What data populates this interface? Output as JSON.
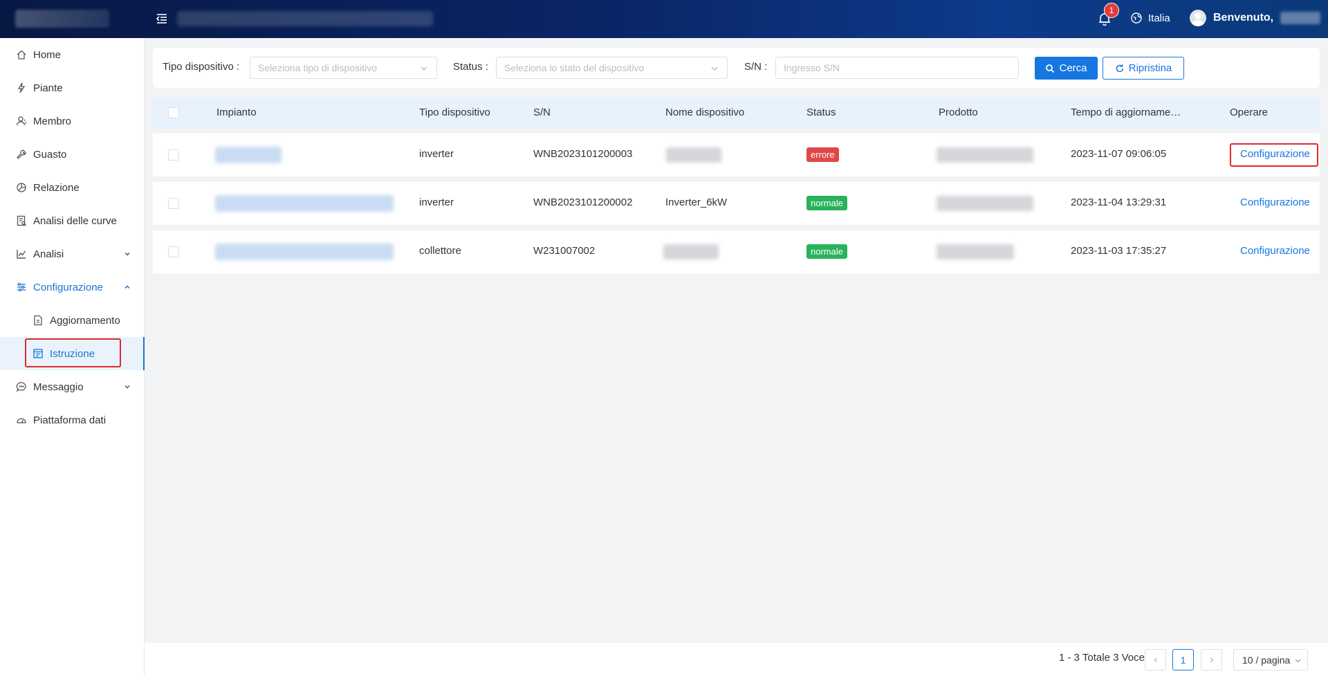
{
  "header": {
    "notification_count": "1",
    "language": "Italia",
    "welcome": "Benvenuto,"
  },
  "sidebar": {
    "items": [
      {
        "label": "Home",
        "icon": "home-icon"
      },
      {
        "label": "Piante",
        "icon": "plant-icon"
      },
      {
        "label": "Membro",
        "icon": "member-icon"
      },
      {
        "label": "Guasto",
        "icon": "wrench-icon"
      },
      {
        "label": "Relazione",
        "icon": "relation-icon"
      },
      {
        "label": "Analisi delle curve",
        "icon": "curve-analysis-icon"
      },
      {
        "label": "Analisi",
        "icon": "chart-icon"
      },
      {
        "label": "Configurazione",
        "icon": "settings-sliders-icon"
      },
      {
        "label": "Aggiornamento",
        "icon": "update-file-icon"
      },
      {
        "label": "Istruzione",
        "icon": "instruction-icon"
      },
      {
        "label": "Messaggio",
        "icon": "message-icon"
      },
      {
        "label": "Piattaforma dati",
        "icon": "dashboard-icon"
      }
    ]
  },
  "filters": {
    "device_type_label": "Tipo dispositivo :",
    "device_type_placeholder": "Seleziona tipo di dispositivo",
    "status_label": "Status :",
    "status_placeholder": "Seleziona lo stato del dispositivo",
    "sn_label": "S/N :",
    "sn_placeholder": "Ingresso S/N",
    "search_button": "Cerca",
    "reset_button": "Ripristina"
  },
  "table": {
    "columns": [
      "Impianto",
      "Tipo dispositivo",
      "S/N",
      "Nome dispositivo",
      "Status",
      "Prodotto",
      "Tempo di aggiorname…",
      "Operare"
    ],
    "rows": [
      {
        "tipo": "inverter",
        "sn": "WNB2023101200003",
        "nome": "",
        "status": "errore",
        "status_kind": "error",
        "tempo": "2023-11-07 09:06:05",
        "action": "Configurazione"
      },
      {
        "tipo": "inverter",
        "sn": "WNB2023101200002",
        "nome": "Inverter_6kW",
        "status": "normale",
        "status_kind": "ok",
        "tempo": "2023-11-04 13:29:31",
        "action": "Configurazione"
      },
      {
        "tipo": "collettore",
        "sn": "W231007002",
        "nome": "",
        "status": "normale",
        "status_kind": "ok",
        "tempo": "2023-11-03 17:35:27",
        "action": "Configurazione"
      }
    ]
  },
  "pagination": {
    "total_text": "1 - 3 Totale 3 Voce",
    "current_page": "1",
    "page_size": "10 / pagina"
  },
  "colors": {
    "primary": "#1677e0",
    "error": "#e04848",
    "success": "#27b25b",
    "header_dark": "#071843"
  }
}
